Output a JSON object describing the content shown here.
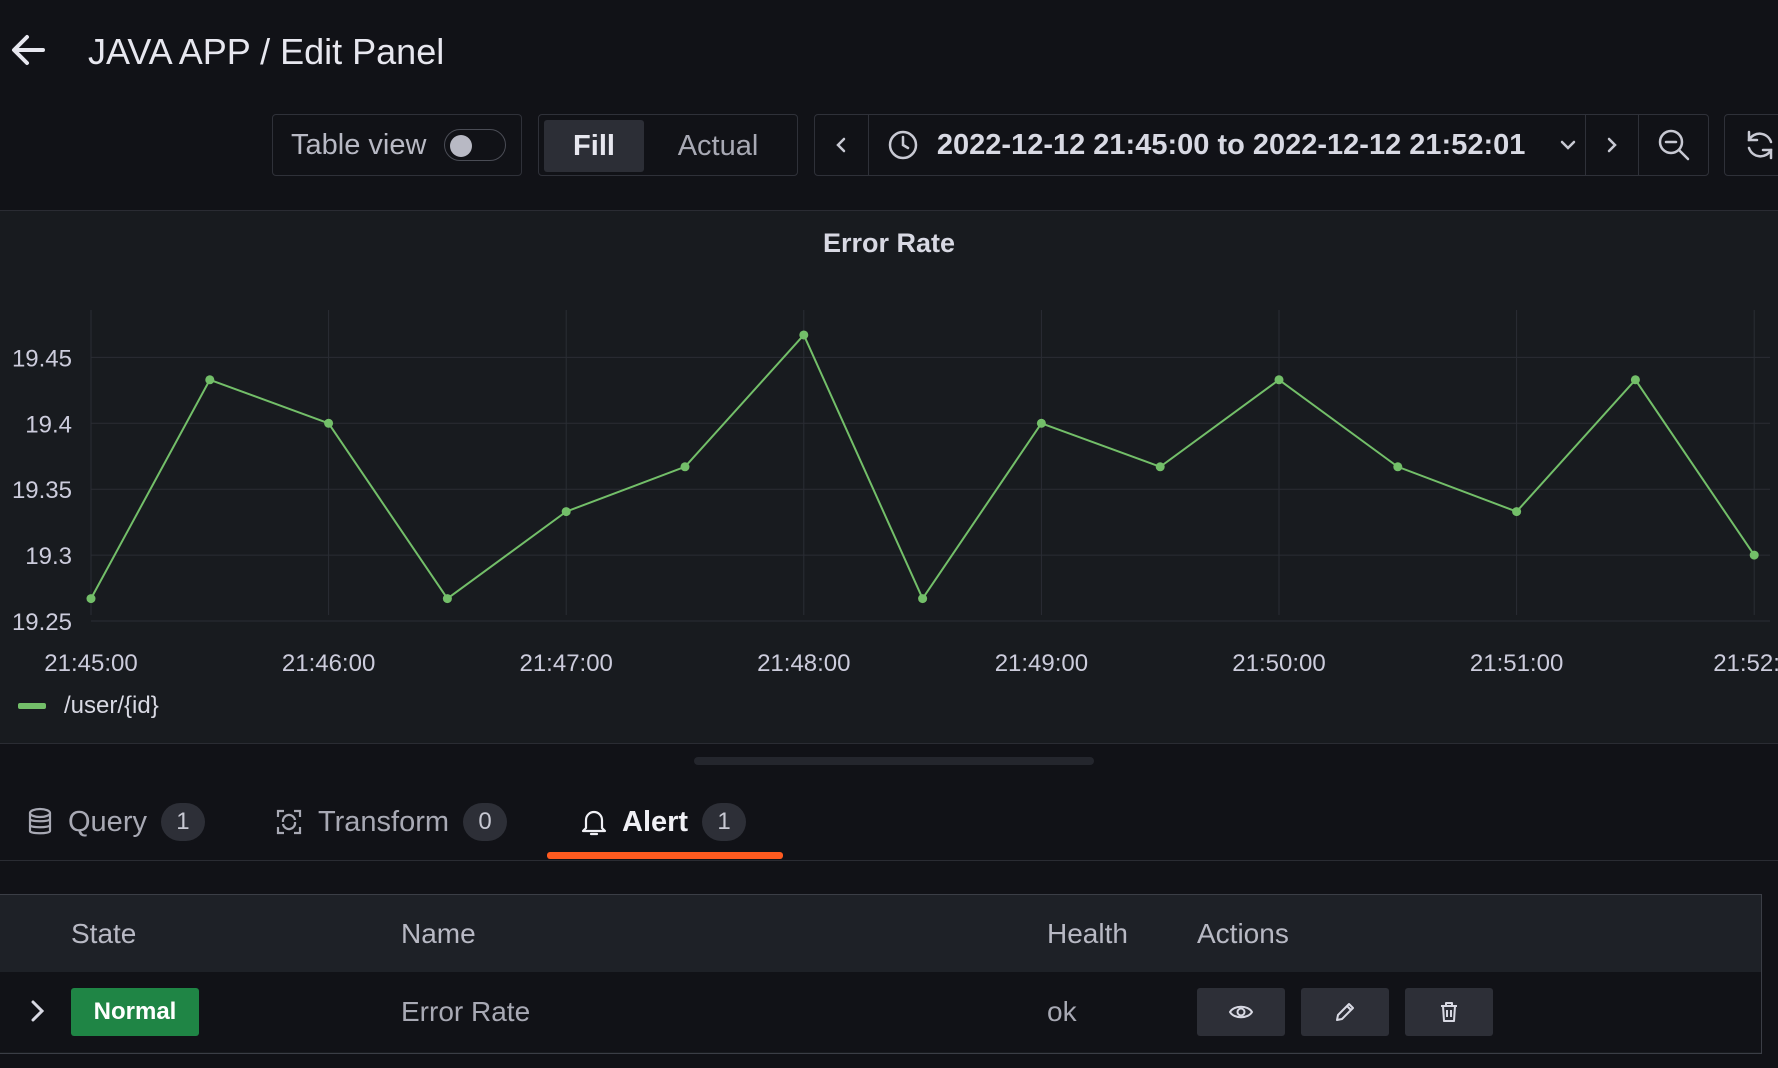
{
  "header": {
    "title": "JAVA APP / Edit Panel"
  },
  "toolbar": {
    "table_view_label": "Table view",
    "table_view_on": false,
    "fill_label": "Fill",
    "actual_label": "Actual",
    "time_range": "2022-12-12 21:45:00 to 2022-12-12 21:52:01"
  },
  "panel": {
    "title": "Error Rate",
    "legend": "/user/{id}"
  },
  "tabs": [
    {
      "label": "Query",
      "count": "1"
    },
    {
      "label": "Transform",
      "count": "0"
    },
    {
      "label": "Alert",
      "count": "1"
    }
  ],
  "alerts": {
    "columns": [
      "State",
      "Name",
      "Health",
      "Actions"
    ],
    "row": {
      "state": "Normal",
      "name": "Error Rate",
      "health": "ok"
    }
  },
  "colors": {
    "series": "#73bf69",
    "active_tab": "#ff5a1f",
    "state_normal": "#1f8545"
  },
  "chart_data": {
    "type": "line",
    "title": "Error Rate",
    "xlabel": "",
    "ylabel": "",
    "x": [
      "21:45:00",
      "21:45:30",
      "21:46:00",
      "21:46:30",
      "21:47:00",
      "21:47:30",
      "21:48:00",
      "21:48:30",
      "21:49:00",
      "21:49:30",
      "21:50:00",
      "21:50:30",
      "21:51:00",
      "21:51:30",
      "21:52:00"
    ],
    "x_ticks": [
      "21:45:00",
      "21:46:00",
      "21:47:00",
      "21:48:00",
      "21:49:00",
      "21:50:00",
      "21:51:00",
      "21:52:"
    ],
    "y_ticks": [
      "19.45",
      "19.4",
      "19.35",
      "19.3",
      "19.25"
    ],
    "ylim": [
      19.25,
      19.49
    ],
    "series": [
      {
        "name": "/user/{id}",
        "values": [
          19.267,
          19.433,
          19.4,
          19.267,
          19.333,
          19.367,
          19.467,
          19.267,
          19.4,
          19.367,
          19.433,
          19.367,
          19.333,
          19.433,
          19.3
        ]
      }
    ],
    "grid": true,
    "legend_position": "bottom-left"
  }
}
